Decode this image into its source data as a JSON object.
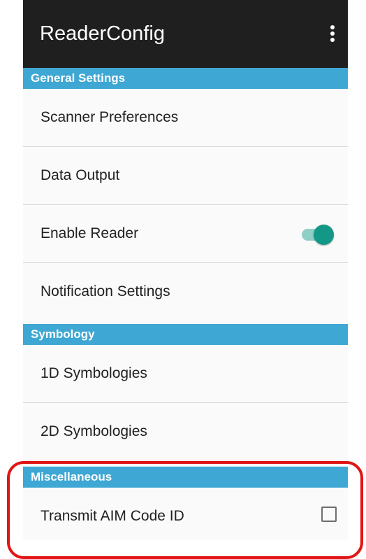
{
  "appbar": {
    "title": "ReaderConfig",
    "menu_icon": "more-vert-icon"
  },
  "sections": [
    {
      "header": "General Settings",
      "items": [
        {
          "label": "Scanner Preferences"
        },
        {
          "label": "Data Output"
        },
        {
          "label": "Enable Reader",
          "control": "switch",
          "checked": true
        },
        {
          "label": "Notification Settings"
        }
      ]
    },
    {
      "header": "Symbology",
      "items": [
        {
          "label": "1D Symbologies"
        },
        {
          "label": "2D Symbologies"
        }
      ]
    },
    {
      "header": "Miscellaneous",
      "items": [
        {
          "label": "Transmit AIM Code ID",
          "control": "checkbox",
          "checked": false
        }
      ]
    }
  ],
  "colors": {
    "appbar_bg": "#1f1f1f",
    "section_header_bg": "#3ea7d3",
    "switch_on": "#139887",
    "highlight_outline": "#e11515"
  }
}
